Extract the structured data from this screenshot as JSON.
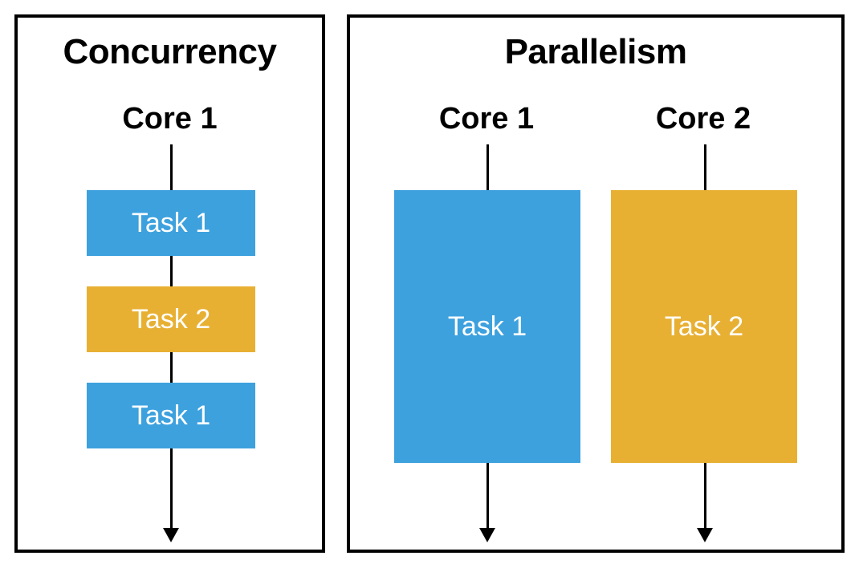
{
  "concurrency": {
    "title": "Concurrency",
    "core_label": "Core 1",
    "tasks": {
      "t1a": "Task 1",
      "t2": "Task 2",
      "t1b": "Task 1"
    }
  },
  "parallelism": {
    "title": "Parallelism",
    "core1_label": "Core 1",
    "core2_label": "Core 2",
    "tasks": {
      "t1": "Task 1",
      "t2": "Task 2"
    }
  },
  "colors": {
    "task_blue": "#3da1de",
    "task_yellow": "#e8b033"
  }
}
